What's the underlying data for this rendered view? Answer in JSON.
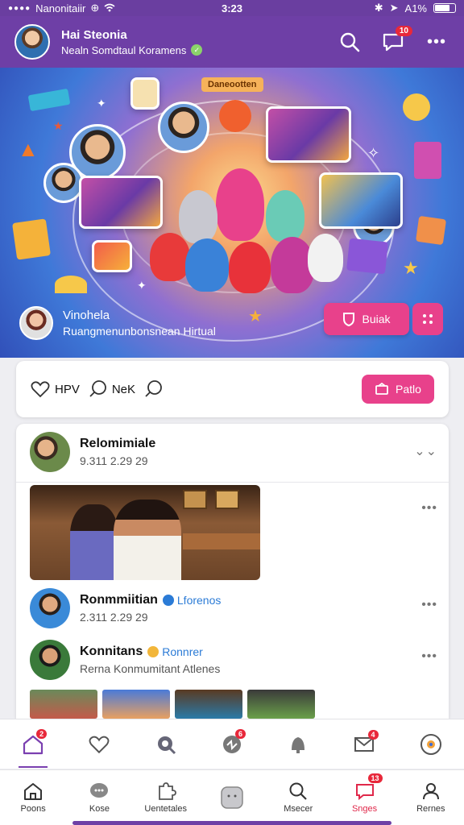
{
  "status_bar": {
    "carrier": "Nanonitaiir",
    "time": "3:23",
    "battery": "A1%"
  },
  "header": {
    "title": "Hai Steonia",
    "subtitle": "Nealn Somdtaul Koramens",
    "notification_count": "10"
  },
  "hero": {
    "tag": "Daneootten",
    "owner_name": "Vinohela",
    "owner_desc": "Ruangmenunbonsnean Hirtual",
    "join_label": "Buiak"
  },
  "reactions": {
    "like_label": "HPV",
    "comment_label": "NeK",
    "post_label": "Patlo"
  },
  "feed": {
    "posts": [
      {
        "name": "Relomimiale",
        "time": "9.311 2.29 29"
      },
      {
        "name": "Ronmmiitian",
        "badge": "Lforenos",
        "time": "2.311 2.29 29"
      },
      {
        "name": "Konnitans",
        "badge": "Ronnrer",
        "time": "Rerna Konmumitant Atlenes"
      }
    ]
  },
  "tab_bar_top": {
    "badges": [
      "2",
      "6",
      "4"
    ]
  },
  "tab_bar_bottom": {
    "items": [
      {
        "label": "Poons"
      },
      {
        "label": "Kose"
      },
      {
        "label": "Uentetales"
      },
      {
        "label": ""
      },
      {
        "label": "Msecer"
      },
      {
        "label": "Snges",
        "badge": "13"
      },
      {
        "label": "Rernes"
      }
    ]
  },
  "colors": {
    "primary": "#6e3fa6",
    "accent": "#e8418b",
    "badge": "#e8283a"
  }
}
